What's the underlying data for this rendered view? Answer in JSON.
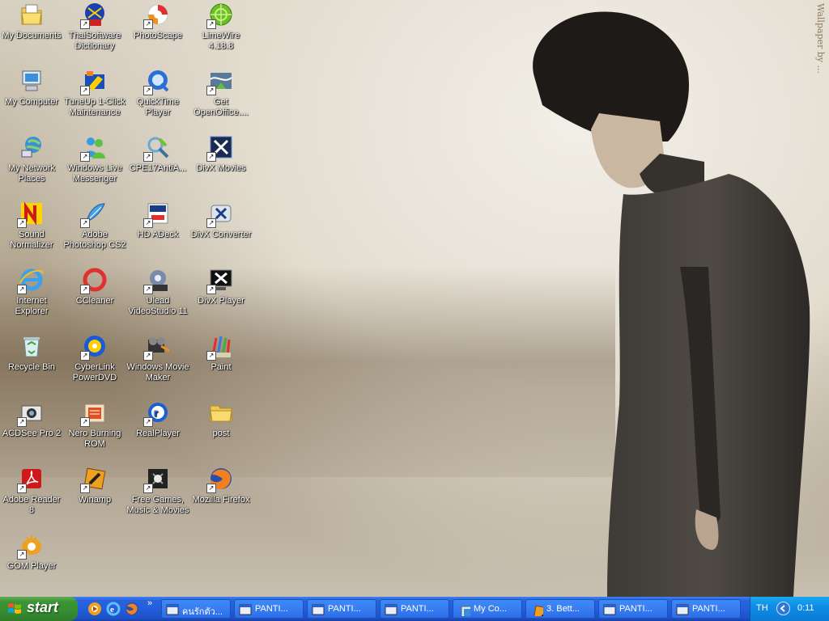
{
  "desktop": {
    "watermark": "Wallpaper by ...",
    "icons": [
      {
        "label": "My Documents",
        "icon": "my-documents-icon"
      },
      {
        "label": "ThaiSoftware Dictionary",
        "icon": "thai-dictionary-icon"
      },
      {
        "label": "PhotoScape",
        "icon": "photoscape-icon"
      },
      {
        "label": "LimeWire 4.18.8",
        "icon": "limewire-icon"
      },
      {
        "label": "My Computer",
        "icon": "my-computer-icon"
      },
      {
        "label": "TuneUp 1-Click Maintenance",
        "icon": "tuneup-icon"
      },
      {
        "label": "QuickTime Player",
        "icon": "quicktime-icon"
      },
      {
        "label": "Get OpenOffice....",
        "icon": "openoffice-icon"
      },
      {
        "label": "My Network Places",
        "icon": "network-places-icon"
      },
      {
        "label": "Windows Live Messenger",
        "icon": "messenger-icon"
      },
      {
        "label": "CPE17AntiA...",
        "icon": "cpe17-icon"
      },
      {
        "label": "DivX Movies",
        "icon": "divx-movies-icon"
      },
      {
        "label": "Sound Normalizer",
        "icon": "sound-normalizer-icon"
      },
      {
        "label": "Adobe Photoshop CS2",
        "icon": "photoshop-icon"
      },
      {
        "label": "HD ADeck",
        "icon": "hd-adeck-icon"
      },
      {
        "label": "DivX Converter",
        "icon": "divx-converter-icon"
      },
      {
        "label": "Internet Explorer",
        "icon": "internet-explorer-icon"
      },
      {
        "label": "CCleaner",
        "icon": "ccleaner-icon"
      },
      {
        "label": "Ulead VideoStudio 11",
        "icon": "ulead-icon"
      },
      {
        "label": "DivX Player",
        "icon": "divx-player-icon"
      },
      {
        "label": "Recycle Bin",
        "icon": "recycle-bin-icon"
      },
      {
        "label": "CyberLink PowerDVD",
        "icon": "powerdvd-icon"
      },
      {
        "label": "Windows Movie Maker",
        "icon": "movie-maker-icon"
      },
      {
        "label": "Paint",
        "icon": "paint-icon"
      },
      {
        "label": "ACDSee Pro 2",
        "icon": "acdsee-icon"
      },
      {
        "label": "Nero Burning ROM",
        "icon": "nero-icon"
      },
      {
        "label": "RealPlayer",
        "icon": "realplayer-icon"
      },
      {
        "label": "post",
        "icon": "folder-icon"
      },
      {
        "label": "Adobe Reader 8",
        "icon": "adobe-reader-icon"
      },
      {
        "label": "Winamp",
        "icon": "winamp-icon"
      },
      {
        "label": "Free Games, Music & Movies",
        "icon": "free-games-icon"
      },
      {
        "label": "Mozilla Firefox",
        "icon": "firefox-icon"
      },
      {
        "label": "GOM Player",
        "icon": "gom-player-icon"
      }
    ]
  },
  "taskbar": {
    "start_label": "start",
    "quicklaunch": [
      {
        "icon": "media-player-icon"
      },
      {
        "icon": "internet-explorer-icon"
      },
      {
        "icon": "firefox-icon"
      }
    ],
    "quicklaunch_more": "»",
    "tasks": [
      {
        "label": "คนรักตัว...",
        "icon": "ie-window-icon"
      },
      {
        "label": "PANTI...",
        "icon": "ie-window-icon"
      },
      {
        "label": "PANTI...",
        "icon": "ie-window-icon"
      },
      {
        "label": "PANTI...",
        "icon": "ie-window-icon"
      },
      {
        "label": "My Co...",
        "icon": "my-computer-icon"
      },
      {
        "label": "3. Bett...",
        "icon": "winamp-icon"
      },
      {
        "label": "PANTI...",
        "icon": "ie-window-icon"
      },
      {
        "label": "PANTI...",
        "icon": "ie-window-icon"
      }
    ],
    "tray": {
      "language": "TH",
      "clock": "0:11"
    }
  }
}
